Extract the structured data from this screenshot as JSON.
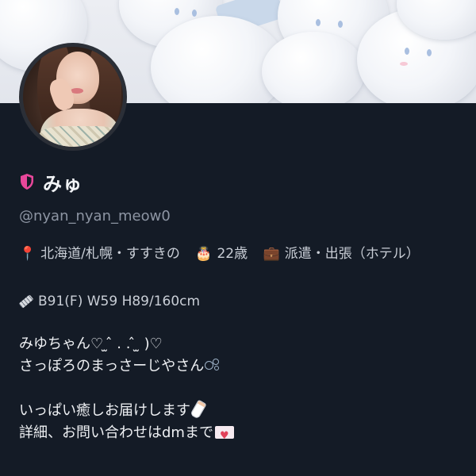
{
  "profile": {
    "display_name": "みゅ",
    "handle": "@nyan_nyan_meow0",
    "location": "北海道/札幌・すすきの",
    "age": "22歳",
    "work": "派遣・出張（ホテル）",
    "measurements": "B91(F) W59 H89/160cm"
  },
  "bio": {
    "line1": "みゆちゃん♡ ̫ ̂ . . ̂ ̫ )♡",
    "line2": "さっぽろのまっさーじやさん",
    "line3": "",
    "line4": "いっぱい癒しお届けします",
    "line5": "詳細、お問い合わせはdmまで"
  },
  "icons": {
    "verified": "pink-shield-icon",
    "location": "round-pushpin-icon",
    "age": "birthday-cake-icon",
    "work": "briefcase-icon",
    "measure": "ruler-icon",
    "bubbles": "bubbles-icon",
    "bottle": "baby-bottle-icon",
    "mail": "love-letter-icon"
  },
  "colors": {
    "background": "#141b26",
    "accent_pink": "#e8479a",
    "muted_text": "#8d95a3"
  }
}
